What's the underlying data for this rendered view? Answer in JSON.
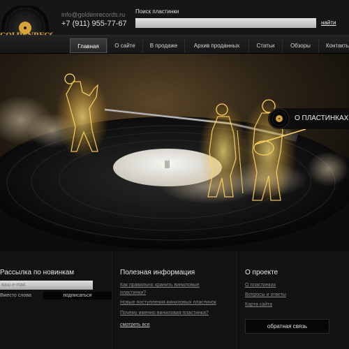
{
  "header": {
    "logo_text": "GOLDENRECORDS",
    "email": "info@goldenrecords.ru",
    "phone": "+7 (911) 955-77-67",
    "search_label": "Поиск пластинки",
    "search_value": "",
    "search_link": "найти"
  },
  "nav": {
    "items": [
      {
        "label": "Главная",
        "active": true
      },
      {
        "label": "О сайте"
      },
      {
        "label": "В продаже"
      },
      {
        "label": "Архив проданных"
      },
      {
        "label": "Статьи"
      },
      {
        "label": "Обзоры"
      },
      {
        "label": "Контакты"
      }
    ]
  },
  "hero": {
    "badge": "О ПЛАСТИНКАХ"
  },
  "footer": {
    "newsletter": {
      "title": "Рассылка по новинкам",
      "email_placeholder": "ваш e-mail",
      "note": "Вместо слова",
      "button": "подписаться"
    },
    "info": {
      "title": "Полезная информация",
      "links": [
        "Как правильно хранить виниловые",
        "пластинки?",
        "Новые поступления виниловых пластинок",
        "Почему именно виниловая пластинка?"
      ],
      "see_all": "смотреть все"
    },
    "about": {
      "title": "О проекте",
      "links": [
        "О пластинках",
        "Вопросы и ответы",
        "Карта сайта"
      ],
      "feedback": "обратная связь"
    }
  },
  "colors": {
    "accent_gold": "#d9a437",
    "background": "#121212"
  }
}
